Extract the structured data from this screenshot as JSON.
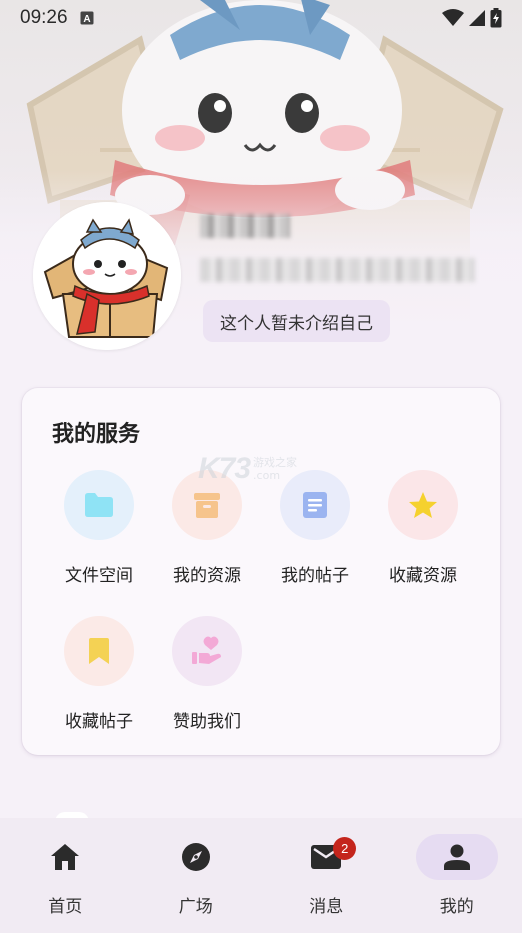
{
  "status_bar": {
    "time": "09:26"
  },
  "profile": {
    "bio": "这个人暂未介绍自己"
  },
  "services": {
    "title": "我的服务",
    "items": [
      {
        "label": "文件空间",
        "icon": "folder-icon",
        "color": "#8fe3f5",
        "bg": "#e4f0fb"
      },
      {
        "label": "我的资源",
        "icon": "archive-box-icon",
        "color": "#f6c48c",
        "bg": "#fbe9e6"
      },
      {
        "label": "我的帖子",
        "icon": "document-icon",
        "color": "#9bb4f0",
        "bg": "#e9ecfa"
      },
      {
        "label": "收藏资源",
        "icon": "star-icon",
        "color": "#f5d12e",
        "bg": "#fbe6e8"
      },
      {
        "label": "收藏帖子",
        "icon": "bookmark-icon",
        "color": "#f4d254",
        "bg": "#fbeae7"
      },
      {
        "label": "赞助我们",
        "icon": "donate-heart-hand-icon",
        "color": "#f3a9d6",
        "bg": "#f2e6f4"
      }
    ]
  },
  "watermark": {
    "logo": "K73",
    "line1": "游戏之家",
    "line2": ".com"
  },
  "bottom_nav": {
    "items": [
      {
        "label": "首页",
        "icon": "home-icon"
      },
      {
        "label": "广场",
        "icon": "compass-icon"
      },
      {
        "label": "消息",
        "icon": "mail-icon",
        "badge": "2"
      },
      {
        "label": "我的",
        "icon": "person-icon",
        "active": true
      }
    ]
  }
}
